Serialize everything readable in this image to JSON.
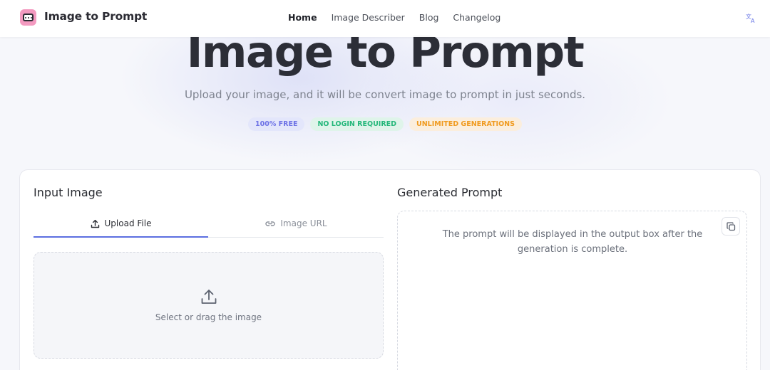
{
  "header": {
    "brand": "Image to Prompt",
    "nav": [
      {
        "label": "Home",
        "active": true
      },
      {
        "label": "Image Describer",
        "active": false
      },
      {
        "label": "Blog",
        "active": false
      },
      {
        "label": "Changelog",
        "active": false
      }
    ],
    "language_icon": "translate-icon"
  },
  "hero": {
    "title": "Image to Prompt",
    "subtitle": "Upload your image, and it will be convert image to prompt in just seconds.",
    "badges": [
      "100% FREE",
      "NO LOGIN REQUIRED",
      "UNLIMITED GENERATIONS"
    ]
  },
  "input_panel": {
    "title": "Input Image",
    "tabs": [
      {
        "label": "Upload File",
        "icon": "upload-icon",
        "active": true
      },
      {
        "label": "Image URL",
        "icon": "link-icon",
        "active": false
      }
    ],
    "dropzone_text": "Select or drag the image"
  },
  "output_panel": {
    "title": "Generated Prompt",
    "placeholder": "The prompt will be displayed in the output box after the generation is complete.",
    "copy_icon": "copy-icon"
  },
  "colors": {
    "accent": "#5b6ee0",
    "badge_free": "#6d72e6",
    "badge_login": "#23b77a",
    "badge_unlimited": "#f09a1f",
    "logo": "#f39ac0"
  }
}
